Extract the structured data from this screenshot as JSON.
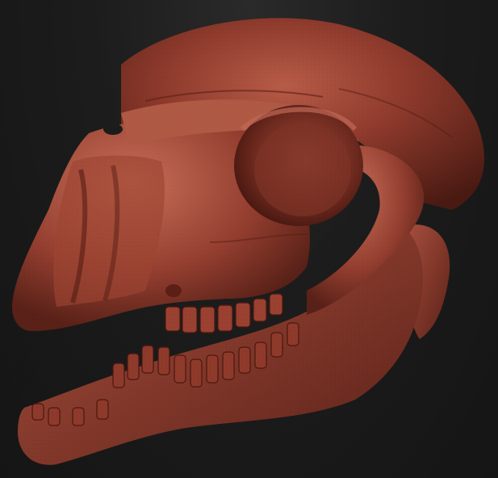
{
  "viewport": {
    "background_top": "#2a2a2a",
    "background_bottom": "#151515"
  },
  "model": {
    "subject": "sculpted-animal-skull",
    "material_color": "#8e3a2c",
    "highlight_color": "#c26a55",
    "shadow_color": "#3e130d",
    "wireframe_visible": true
  }
}
